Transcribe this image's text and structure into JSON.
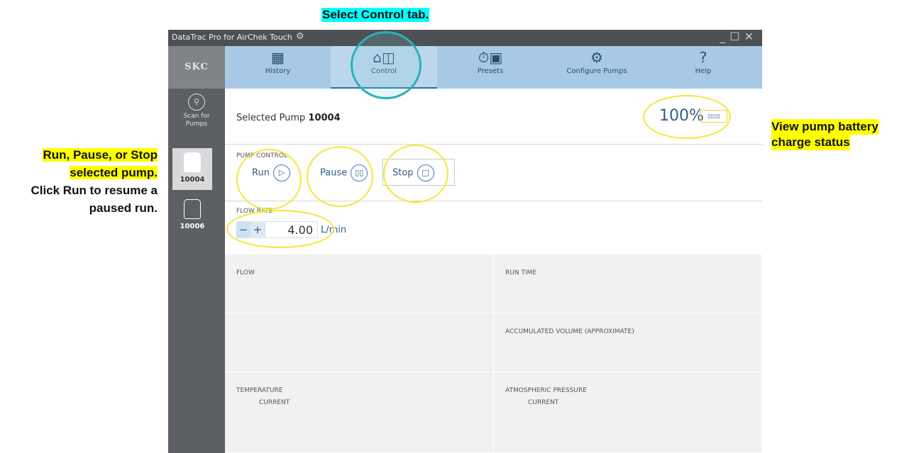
{
  "callouts": {
    "top": "Select Control tab.",
    "right_line1": "View pump battery",
    "right_line2": "charge status",
    "left_line1": "Run, Pause, or Stop",
    "left_line2": "selected pump.",
    "left_line3": "Click Run to resume a",
    "left_line4": "paused run."
  },
  "window": {
    "title": "DataTrac Pro for AirChek Touch"
  },
  "sidebar": {
    "logo": "SKC",
    "scan_line1": "Scan for",
    "scan_line2": "Pumps",
    "pumps": [
      {
        "label": "10004",
        "selected": true
      },
      {
        "label": "10006",
        "selected": false
      }
    ]
  },
  "tabs": [
    {
      "label": "History",
      "icon": "calendar-grid-icon"
    },
    {
      "label": "Control",
      "icon": "pump-control-icon",
      "active": true
    },
    {
      "label": "Presets",
      "icon": "timer-calendar-icon"
    },
    {
      "label": "Configure Pumps",
      "icon": "gear-icon"
    },
    {
      "label": "Help",
      "icon": "question-icon"
    }
  ],
  "main": {
    "selected_pump_prefix": "Selected Pump",
    "selected_pump_id": "10004",
    "battery_percent": "100%",
    "pump_control_label": "PUMP CONTROL",
    "run_label": "Run",
    "pause_label": "Pause",
    "stop_label": "Stop",
    "flow_rate_label": "FLOW RATE",
    "flow_rate_value": "4.00",
    "flow_rate_unit": "L/min",
    "cells": {
      "flow": "FLOW",
      "run_time": "RUN TIME",
      "accumulated_volume": "ACCUMULATED VOLUME (APPROXIMATE)",
      "temperature": "TEMPERATURE",
      "temperature_sub": "CURRENT",
      "atmospheric_pressure": "ATMOSPHERIC PRESSURE",
      "atmospheric_sub": "CURRENT"
    }
  },
  "colors": {
    "highlight_yellow": "#ffff00",
    "highlight_cyan": "#00ffff",
    "tab_bar": "#a7c9e6",
    "accent": "#2f5f8a"
  }
}
